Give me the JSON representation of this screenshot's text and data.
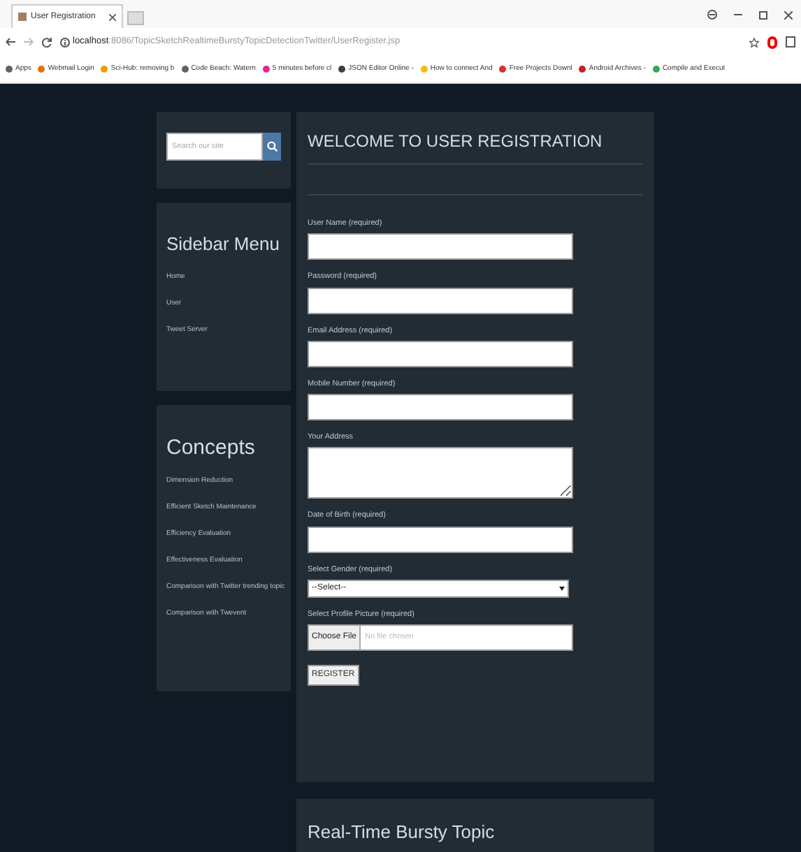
{
  "browser": {
    "tab_title": "User Registration",
    "url_host": "localhost",
    "url_rest": ":8086/TopicSketchRealtimeBurstyTopicDetectionTwitter/UserRegister.jsp",
    "bookmarks": [
      {
        "label": "Apps",
        "color": "#5f6368"
      },
      {
        "label": "Webmail Login",
        "color": "#e8710a"
      },
      {
        "label": "Sci-Hub: removing b",
        "color": "#f29900"
      },
      {
        "label": "Code Beach: Watern",
        "color": "#5f6368"
      },
      {
        "label": "5 minutes before cl",
        "color": "#e52592"
      },
      {
        "label": "JSON Editor Online -",
        "color": "#3c4043"
      },
      {
        "label": "How to connect And",
        "color": "#fbbc04"
      },
      {
        "label": "Free Projects Downl",
        "color": "#d93025"
      },
      {
        "label": "Android Archives - ",
        "color": "#c5221f"
      },
      {
        "label": "Compile and Execut",
        "color": "#34a853"
      }
    ]
  },
  "search": {
    "placeholder": "Search our site"
  },
  "sidebar_menu": {
    "title": "Sidebar Menu",
    "items": [
      "Home",
      "User",
      "Tweet Server"
    ]
  },
  "concepts": {
    "title": "Concepts",
    "items": [
      "Dimension Reduction",
      "Efficient Sketch Maintenance",
      "Efficiency Evaluation",
      "Effectiveness Evaluation",
      "Comparison with Twitter trending topic",
      "Comparison with Twevent"
    ]
  },
  "form": {
    "title": "WELCOME TO USER REGISTRATION",
    "fields": [
      {
        "kind": "text",
        "label": "User Name (required)"
      },
      {
        "kind": "text",
        "label": "Password (required)"
      },
      {
        "kind": "text",
        "label": "Email Address (required)"
      },
      {
        "kind": "text",
        "label": "Mobile Number (required)"
      },
      {
        "kind": "textarea",
        "label": "Your Address"
      },
      {
        "kind": "text",
        "label": "Date of Birth (required)"
      },
      {
        "kind": "select",
        "label": "Select Gender (required)",
        "value": "--Select--"
      },
      {
        "kind": "file",
        "label": "Select Profile Picture (required)",
        "button": "Choose File",
        "value": "No file chosen"
      }
    ],
    "submit": "REGISTER"
  },
  "next_section": {
    "title": "Real-Time Bursty Topic"
  }
}
